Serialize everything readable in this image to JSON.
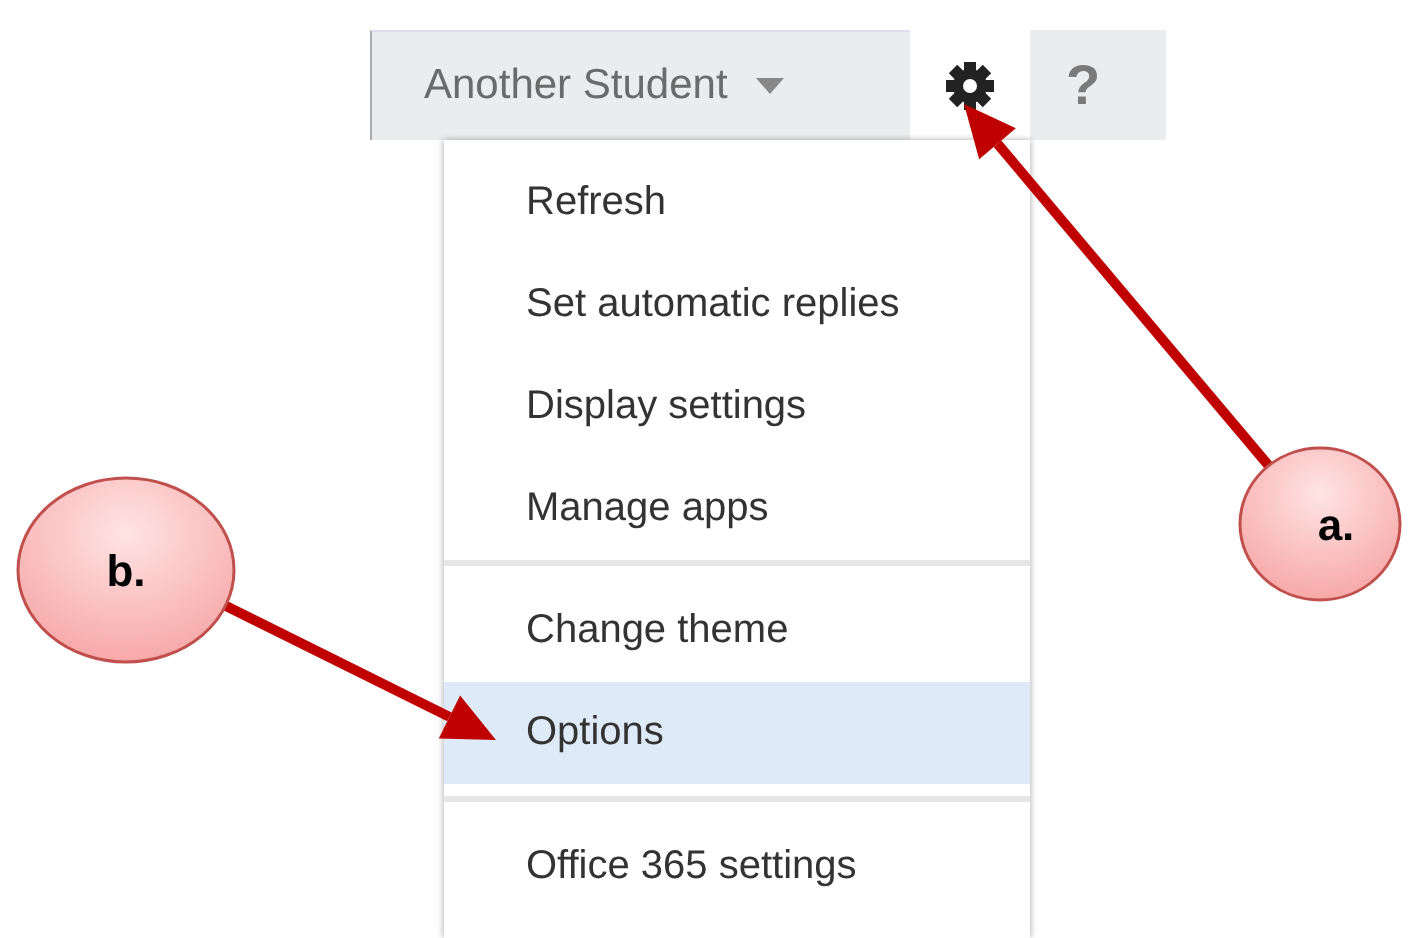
{
  "top_bar": {
    "account_name": "Another Student",
    "help": "?"
  },
  "menu": {
    "sections": [
      [
        {
          "label": "Refresh",
          "selected": false
        },
        {
          "label": "Set automatic replies",
          "selected": false
        },
        {
          "label": "Display settings",
          "selected": false
        },
        {
          "label": "Manage apps",
          "selected": false
        }
      ],
      [
        {
          "label": "Change theme",
          "selected": false
        },
        {
          "label": "Options",
          "selected": true
        }
      ],
      [
        {
          "label": "Office 365 settings",
          "selected": false
        }
      ]
    ]
  },
  "callouts": [
    {
      "label": "a."
    },
    {
      "label": "b."
    }
  ]
}
